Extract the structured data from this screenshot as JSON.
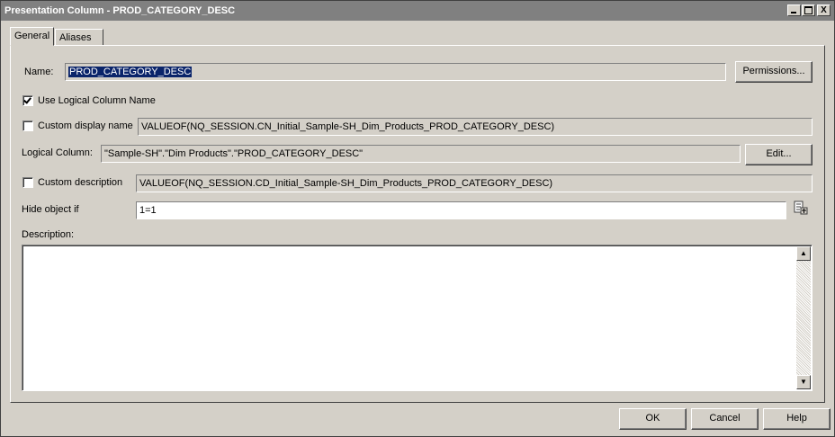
{
  "window": {
    "title": "Presentation Column - PROD_CATEGORY_DESC",
    "controls": {
      "minimize": "_",
      "maximize": "□",
      "close": "X"
    }
  },
  "tabs": [
    {
      "label": "General",
      "active": true
    },
    {
      "label": "Aliases",
      "active": false
    }
  ],
  "name": {
    "label": "Name:",
    "value": "PROD_CATEGORY_DESC",
    "permissions_label": "Permissions..."
  },
  "use_logical": {
    "label": "Use Logical Column Name",
    "checked": true
  },
  "custom_display": {
    "label": "Custom display name",
    "checked": false,
    "value": "VALUEOF(NQ_SESSION.CN_Initial_Sample-SH_Dim_Products_PROD_CATEGORY_DESC)"
  },
  "logical_column": {
    "label": "Logical Column:",
    "value": "\"Sample-SH\".\"Dim Products\".\"PROD_CATEGORY_DESC\"",
    "edit_label": "Edit..."
  },
  "custom_description": {
    "label": "Custom description",
    "checked": false,
    "value": "VALUEOF(NQ_SESSION.CD_Initial_Sample-SH_Dim_Products_PROD_CATEGORY_DESC)"
  },
  "hide_object": {
    "label": "Hide object if",
    "value": "1=1",
    "icon": "expression-builder-icon"
  },
  "description": {
    "label": "Description:",
    "value": ""
  },
  "footer": {
    "ok": "OK",
    "cancel": "Cancel",
    "help": "Help"
  },
  "colors": {
    "face": "#d4d0c8",
    "title_bg": "#808080",
    "selection": "#0a246a"
  }
}
